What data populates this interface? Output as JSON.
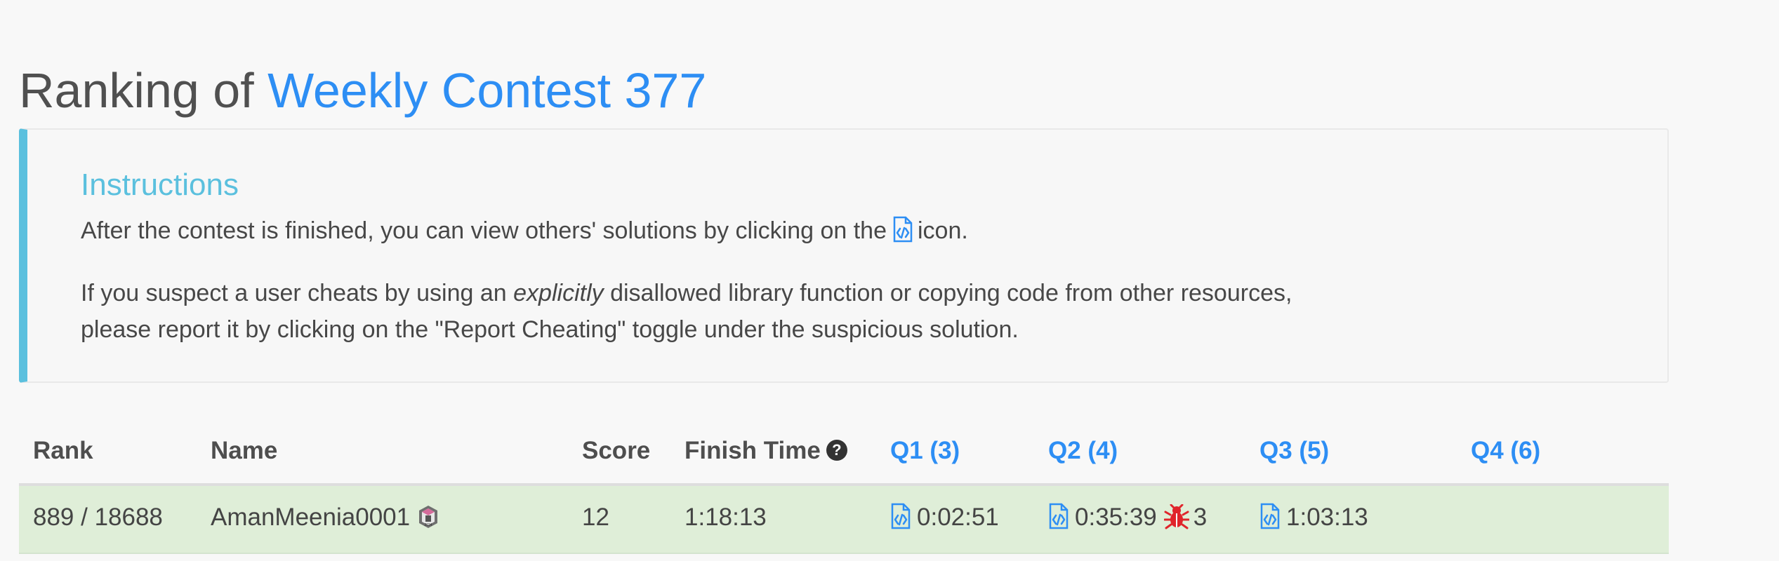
{
  "page": {
    "title_prefix": "Ranking of ",
    "contest_name": "Weekly Contest 377"
  },
  "instructions": {
    "title": "Instructions",
    "line1_before_icon": "After the contest is finished, you can view others' solutions by clicking on the",
    "line1_after_icon": "icon.",
    "line2_before_italic": "If you suspect a user cheats by using an ",
    "line2_italic": "explicitly",
    "line2_after_italic": " disallowed library function or copying code from other resources,",
    "line3": "please report it by clicking on the \"Report Cheating\" toggle under the suspicious solution.",
    "solution_icon_name": "code-file-icon"
  },
  "table": {
    "headers": {
      "rank": "Rank",
      "name": "Name",
      "score": "Score",
      "finish_time": "Finish Time",
      "q1": "Q1 (3)",
      "q2": "Q2 (4)",
      "q3": "Q3 (5)",
      "q4": "Q4 (6)"
    },
    "help_icon_name": "question-circle-icon",
    "rows": [
      {
        "rank": "889 / 18688",
        "name": "AmanMeenia0001",
        "badge_icon_name": "contest-badge-icon",
        "score": "12",
        "finish_time": "1:18:13",
        "q1": "0:02:51",
        "q2": "0:35:39",
        "q2_bug_icon_name": "bug-icon",
        "q2_penalty": "3",
        "q3": "1:03:13",
        "q4": ""
      }
    ]
  },
  "colors": {
    "link_blue": "#2d8ef4",
    "info_cyan": "#5bc0de",
    "row_green": "#dfeed8",
    "bug_red": "#e0242b"
  }
}
